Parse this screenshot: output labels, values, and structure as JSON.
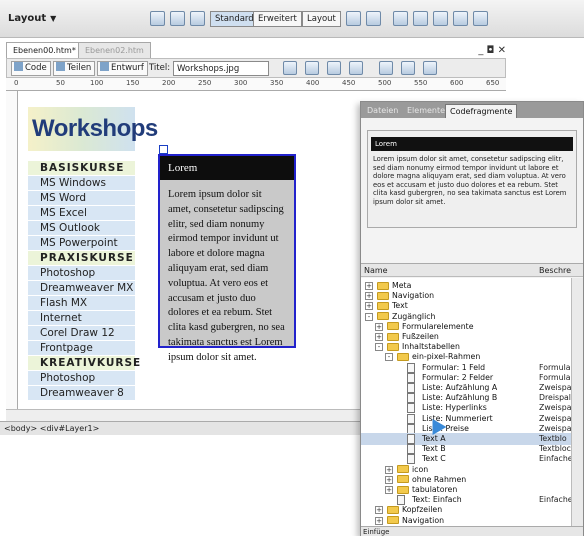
{
  "toolbar": {
    "layout_label": "Layout",
    "views": [
      "Standard",
      "Erweitert",
      "Layout"
    ],
    "active_view": "Standard"
  },
  "document": {
    "tabs": [
      "Ebenen00.htm*",
      "Ebenen02.htm"
    ],
    "buttons": {
      "code": "Code",
      "split": "Teilen",
      "design": "Entwurf"
    },
    "title_label": "Titel:",
    "title_value": "Workshops.jpg",
    "ruler_ticks": [
      "0",
      "50",
      "100",
      "150",
      "200",
      "250",
      "300",
      "350",
      "400",
      "450",
      "500",
      "550",
      "600",
      "650"
    ]
  },
  "page": {
    "logo": "Workshops",
    "nav": [
      {
        "label": "BASISKURSE",
        "header": true
      },
      {
        "label": "MS Windows",
        "header": false
      },
      {
        "label": "MS Word",
        "header": false
      },
      {
        "label": "MS Excel",
        "header": false
      },
      {
        "label": "MS Outlook",
        "header": false
      },
      {
        "label": "MS Powerpoint",
        "header": false
      },
      {
        "label": "PRAXISKURSE",
        "header": true
      },
      {
        "label": "Photoshop",
        "header": false
      },
      {
        "label": "Dreamweaver MX",
        "header": false
      },
      {
        "label": "Flash MX",
        "header": false
      },
      {
        "label": "Internet",
        "header": false
      },
      {
        "label": "Corel Draw 12",
        "header": false
      },
      {
        "label": "Frontpage",
        "header": false
      },
      {
        "label": "KREATIVKURSE",
        "header": true
      },
      {
        "label": "Photoshop",
        "header": false
      },
      {
        "label": "Dreamweaver 8",
        "header": false
      }
    ],
    "layer_title": "Lorem",
    "layer_text": "Lorem ipsum dolor sit amet, consetetur sadipscing elitr, sed diam nonumy eirmod tempor invidunt ut labore et dolore magna aliquyam erat, sed diam voluptua. At vero eos et accusam et justo duo dolores et ea rebum. Stet clita kasd gubergren, no sea takimata sanctus est Lorem ipsum dolor sit amet."
  },
  "statusbar": {
    "path": "<body> <div#Layer1>"
  },
  "panel": {
    "tabs": [
      "Dateien",
      "Elemente",
      "Codefragmente"
    ],
    "active_tab": "Codefragmente",
    "preview_title": "Lorem",
    "preview_text": "Lorem ipsum dolor sit amet, consetetur sadipscing elitr, sed diam nonumy eirmod tempor invidunt ut labore et dolore magna aliquyam erat, sed diam voluptua. At vero eos et accusam et justo duo dolores et ea rebum. Stet clita kasd gubergren, no sea takimata sanctus est Lorem ipsum dolor sit amet.",
    "col_name": "Name",
    "col_desc": "Beschre",
    "tree": [
      {
        "label": "Meta",
        "depth": 0,
        "kind": "folder",
        "exp": "+",
        "type": ""
      },
      {
        "label": "Navigation",
        "depth": 0,
        "kind": "folder",
        "exp": "+",
        "type": ""
      },
      {
        "label": "Text",
        "depth": 0,
        "kind": "folder",
        "exp": "+",
        "type": ""
      },
      {
        "label": "Zugänglich",
        "depth": 0,
        "kind": "folder",
        "exp": "-",
        "type": ""
      },
      {
        "label": "Formularelemente",
        "depth": 1,
        "kind": "folder",
        "exp": "+",
        "type": ""
      },
      {
        "label": "Fußzeilen",
        "depth": 1,
        "kind": "folder",
        "exp": "+",
        "type": ""
      },
      {
        "label": "Inhaltstabellen",
        "depth": 1,
        "kind": "folder",
        "exp": "-",
        "type": ""
      },
      {
        "label": "ein-pixel-Rahmen",
        "depth": 2,
        "kind": "folder",
        "exp": "-",
        "type": ""
      },
      {
        "label": "Formular: 1 Feld",
        "depth": 3,
        "kind": "file",
        "exp": "",
        "type": "Formula"
      },
      {
        "label": "Formular: 2 Felder",
        "depth": 3,
        "kind": "file",
        "exp": "",
        "type": "Formula"
      },
      {
        "label": "Liste: Aufzählung A",
        "depth": 3,
        "kind": "file",
        "exp": "",
        "type": "Zweispa"
      },
      {
        "label": "Liste: Aufzählung B",
        "depth": 3,
        "kind": "file",
        "exp": "",
        "type": "Dreispal"
      },
      {
        "label": "Liste: Hyperlinks",
        "depth": 3,
        "kind": "file",
        "exp": "",
        "type": "Zweispa"
      },
      {
        "label": "Liste: Nummeriert",
        "depth": 3,
        "kind": "file",
        "exp": "",
        "type": "Zweispa"
      },
      {
        "label": "Liste: Preise",
        "depth": 3,
        "kind": "file",
        "exp": "",
        "type": "Zweispa"
      },
      {
        "label": "Text A",
        "depth": 3,
        "kind": "file",
        "exp": "",
        "type": "Textblo",
        "selected": true
      },
      {
        "label": "Text B",
        "depth": 3,
        "kind": "file",
        "exp": "",
        "type": "Textbloc"
      },
      {
        "label": "Text C",
        "depth": 3,
        "kind": "file",
        "exp": "",
        "type": "Einfache"
      },
      {
        "label": "icon",
        "depth": 2,
        "kind": "folder",
        "exp": "+",
        "type": ""
      },
      {
        "label": "ohne Rahmen",
        "depth": 2,
        "kind": "folder",
        "exp": "+",
        "type": ""
      },
      {
        "label": "tabulatoren",
        "depth": 2,
        "kind": "folder",
        "exp": "+",
        "type": ""
      },
      {
        "label": "Text: Einfach",
        "depth": 2,
        "kind": "file",
        "exp": "",
        "type": "Einfache"
      },
      {
        "label": "Kopfzeilen",
        "depth": 1,
        "kind": "folder",
        "exp": "+",
        "type": ""
      },
      {
        "label": "Navigation",
        "depth": 1,
        "kind": "folder",
        "exp": "+",
        "type": ""
      }
    ],
    "footer": "Einfüge"
  }
}
